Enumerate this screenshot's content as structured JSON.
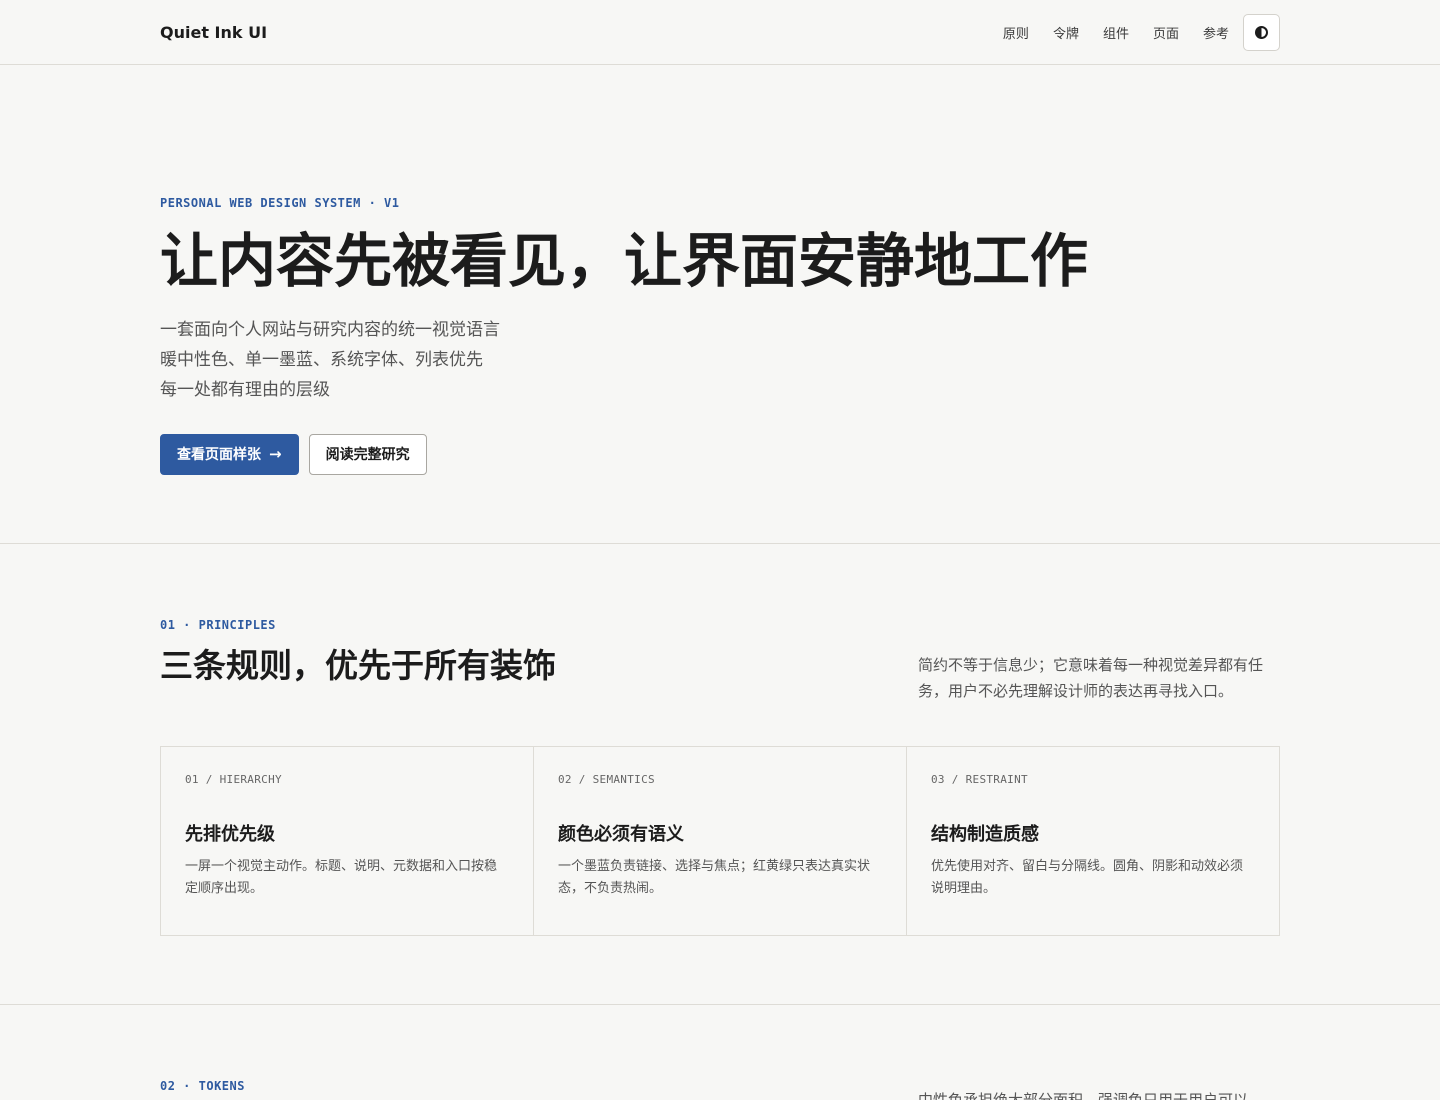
{
  "header": {
    "brand": "Quiet Ink UI",
    "nav": [
      "原则",
      "令牌",
      "组件",
      "页面",
      "参考"
    ]
  },
  "hero": {
    "eyebrow": "PERSONAL WEB DESIGN SYSTEM · V1",
    "title": "让内容先被看见，让界面安静地工作",
    "subtitle": [
      "一套面向个人网站与研究内容的统一视觉语言",
      "暖中性色、单一墨蓝、系统字体、列表优先",
      "每一处都有理由的层级"
    ],
    "primary_button": "查看页面样张",
    "primary_arrow": "→",
    "secondary_button": "阅读完整研究"
  },
  "principles": {
    "eyebrow": "01 · PRINCIPLES",
    "title": "三条规则，优先于所有装饰",
    "note": "简约不等于信息少；它意味着每一种视觉差异都有任务，用户不必先理解设计师的表达再寻找入口。",
    "cards": [
      {
        "tag": "01 / HIERARCHY",
        "title": "先排优先级",
        "body": "一屏一个视觉主动作。标题、说明、元数据和入口按稳定顺序出现。"
      },
      {
        "tag": "02 / SEMANTICS",
        "title": "颜色必须有语义",
        "body": "一个墨蓝负责链接、选择与焦点；红黄绿只表达真实状态，不负责热闹。"
      },
      {
        "tag": "03 / RESTRAINT",
        "title": "结构制造质感",
        "body": "优先使用对齐、留白与分隔线。圆角、阴影和动效必须说明理由。"
      }
    ]
  },
  "tokens": {
    "eyebrow": "02 · TOKENS",
    "note": "中性色承担绝大部分面积，强调色只用于用户可以"
  },
  "colors": {
    "accent": "#2e5aa0",
    "background": "#f7f7f5",
    "text": "#1c1c1c",
    "muted": "#555555",
    "border": "#dedcd6"
  },
  "icons": {
    "theme_toggle": "contrast-icon"
  }
}
